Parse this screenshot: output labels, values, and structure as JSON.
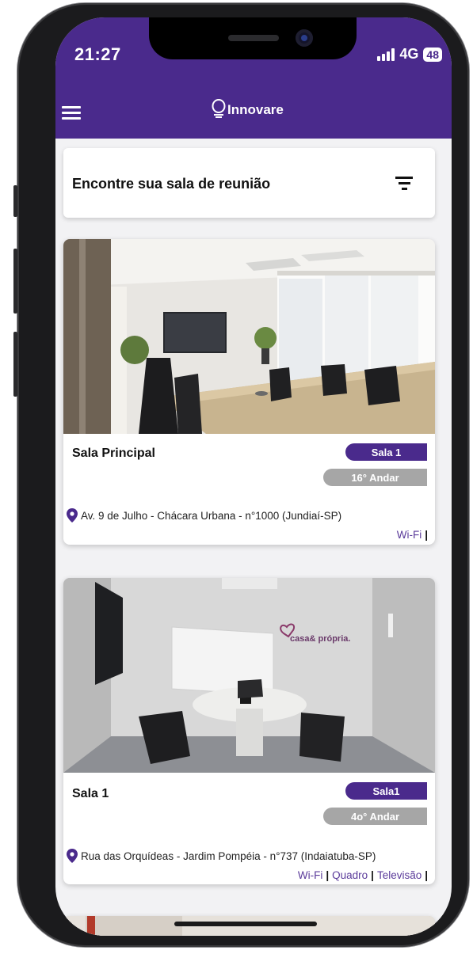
{
  "status_bar": {
    "time": "21:27",
    "network": "4G",
    "battery": "48"
  },
  "header": {
    "brand": "Innovare",
    "menu_icon": "hamburger-menu-icon",
    "logo_icon": "lightbulb-icon"
  },
  "search": {
    "title": "Encontre sua sala de reunião",
    "filter_icon": "filter-icon"
  },
  "rooms": [
    {
      "name": "Sala Principal",
      "tag": "Sala 1",
      "floor": "16° Andar",
      "address": "Av. 9 de Julho - Chácara Urbana - n°1000 (Jundiaí-SP)",
      "amenities": [
        "Wi-Fi"
      ]
    },
    {
      "name": "Sala 1",
      "tag": "Sala1",
      "floor": "4o° Andar",
      "address": "Rua das Orquídeas - Jardim Pompéia - n°737 (Indaiatuba-SP)",
      "amenities": [
        "Wi-Fi",
        "Quadro",
        "Televisão"
      ],
      "wall_logo": "casa& própria."
    }
  ],
  "colors": {
    "primary": "#4a2a8c",
    "floor_tag": "#a6a6a6",
    "amenity_text": "#5a3a9a"
  }
}
